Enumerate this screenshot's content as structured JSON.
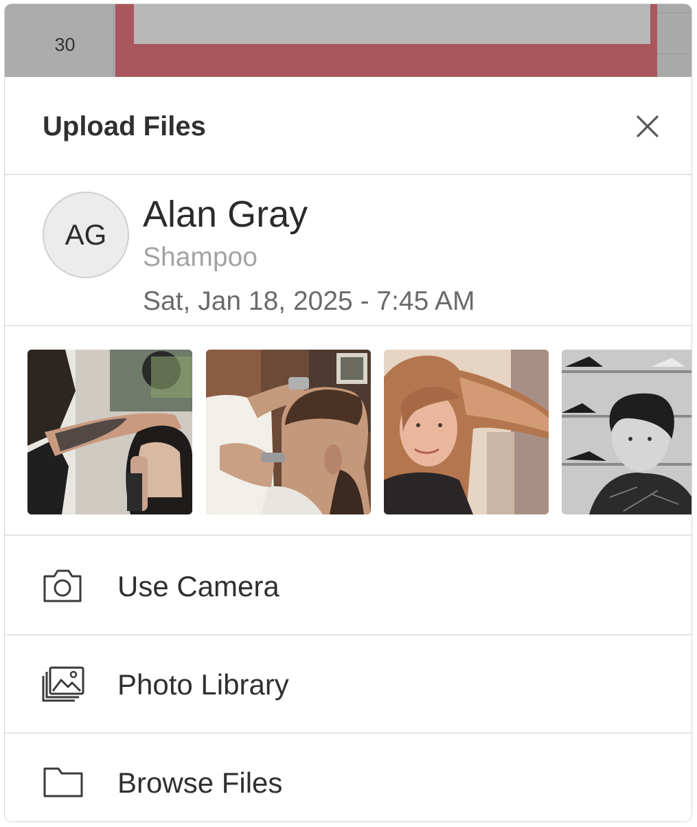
{
  "background": {
    "time_label": "30",
    "event_color": "#a9575c"
  },
  "sheet": {
    "title": "Upload Files",
    "close_icon": "close-icon"
  },
  "client": {
    "initials": "AG",
    "name": "Alan Gray",
    "service": "Shampoo",
    "datetime": "Sat, Jan 18, 2025 - 7:45 AM"
  },
  "gallery": {
    "photos": [
      {
        "name": "photo-barber-clipper-tattoo"
      },
      {
        "name": "photo-barber-fade-cut"
      },
      {
        "name": "photo-woman-long-hair"
      },
      {
        "name": "photo-boy-haircut-bw"
      }
    ]
  },
  "options": [
    {
      "label": "Use Camera",
      "icon": "camera-icon"
    },
    {
      "label": "Photo Library",
      "icon": "photo-library-icon"
    },
    {
      "label": "Browse Files",
      "icon": "folder-icon"
    }
  ]
}
